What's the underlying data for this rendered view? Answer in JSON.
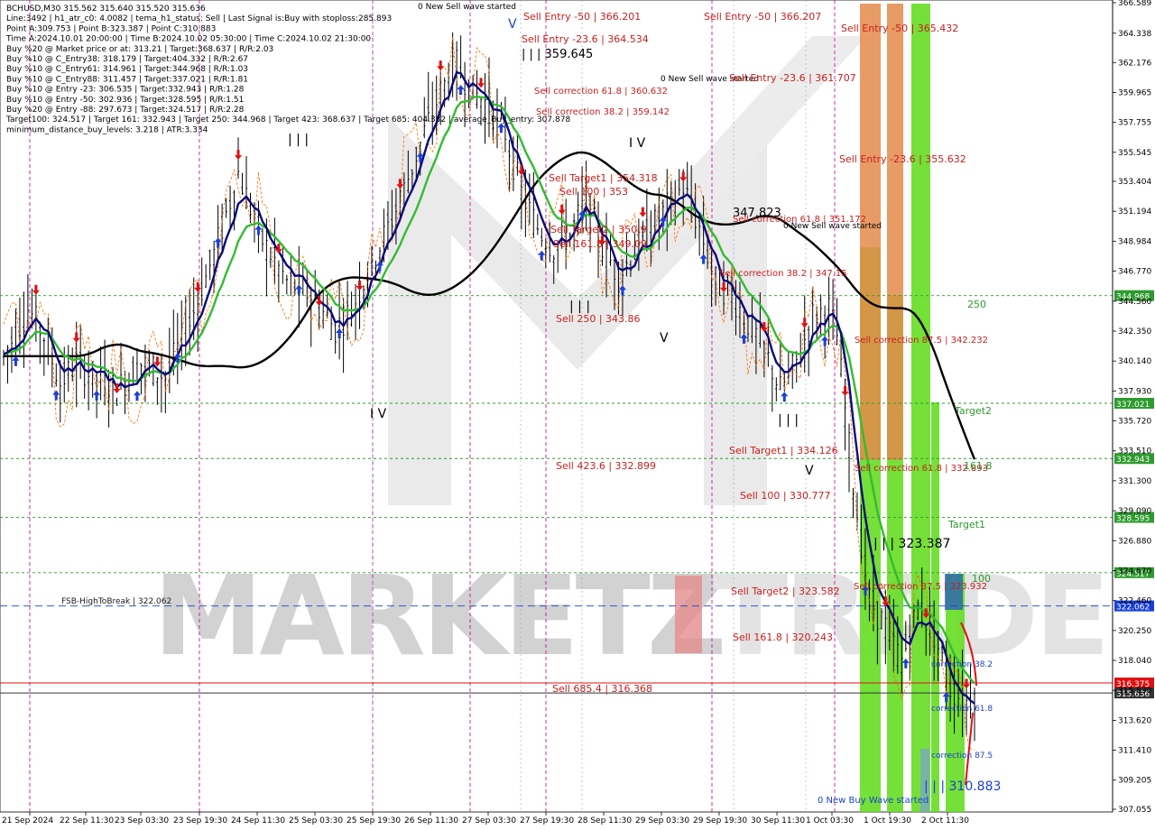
{
  "info_panel": {
    "lines": [
      "BCHUSD,M30  315.562 315.640 315.520 315.636",
      "Line:3492 | h1_atr_c0: 4.0082 | tema_h1_status: Sell | Last Signal is:Buy with stoploss:285.893",
      "Point A:309.753 | Point B:323.387 | Point C:310.883",
      "Time A:2024.10.01 20:00:00 | Time B:2024.10.02 05:30:00 | Time C:2024.10.02 21:30:00",
      "Buy %20 @ Market price or at: 313.21 | Target:368.637 | R/R:2.03",
      "Buy %10 @ C_Entry38: 318.179 | Target:404.332 | R/R:2.67",
      "Buy %10 @ C_Entry61: 314.961 | Target:344.968 | R/R:1.03",
      "Buy %10 @ C_Entry88: 311.457 | Target:337.021 | R/R:1.81",
      "Buy %10 @ Entry -23: 306.535 | Target:332.943 | R/R:1.28",
      "Buy %10 @ Entry -50: 302.936 | Target:328.595 | R/R:1.51",
      "Buy %20 @ Entry -88: 297.673 | Target:324.517 | R/R:2.28",
      "Target100: 324.517 | Target 161: 332.943 | Target 250: 344.968 | Target 423: 368.637 | Target 685: 404.332 | average_Buy_entry: 307.878",
      "minimum_distance_buy_levels: 3.218 | ATR:3.334"
    ]
  },
  "watermark": {
    "text_left": "MARKETZ",
    "text_right": "TRADE"
  },
  "chart_data": {
    "type": "candlestick",
    "symbol": "BCHUSD",
    "timeframe": "M30",
    "ylim": [
      307.055,
      366.589
    ],
    "y_ticks": [
      "366.589",
      "364.338",
      "362.176",
      "359.965",
      "357.755",
      "355.545",
      "353.404",
      "351.194",
      "348.984",
      "346.770",
      "344.560",
      "342.350",
      "340.140",
      "337.930",
      "335.720",
      "333.510",
      "331.300",
      "329.090",
      "326.880",
      "324.670",
      "322.460",
      "320.250",
      "318.040",
      "315.830",
      "313.620",
      "311.410",
      "309.205",
      "307.055"
    ],
    "x_tick_labels": [
      "21 Sep 2024",
      "22 Sep 11:30",
      "23 Sep 03:30",
      "23 Sep 19:30",
      "24 Sep 11:30",
      "25 Sep 03:30",
      "25 Sep 19:30",
      "26 Sep 11:30",
      "27 Sep 03:30",
      "27 Sep 19:30",
      "28 Sep 11:30",
      "29 Sep 03:30",
      "29 Sep 19:30",
      "30 Sep 11:30",
      "1 Oct 03:30",
      "1 Oct 19:30",
      "2 Oct 11:30"
    ],
    "horizontal_levels": [
      {
        "value": 344.968,
        "label": "344.968",
        "color": "#2e9b2e",
        "style": "dotted"
      },
      {
        "value": 337.021,
        "label": "337.021",
        "color": "#2e9b2e",
        "style": "dotted"
      },
      {
        "value": 332.943,
        "label": "332.943",
        "color": "#2e9b2e",
        "style": "dotted"
      },
      {
        "value": 328.595,
        "label": "328.595",
        "color": "#2e9b2e",
        "style": "dotted"
      },
      {
        "value": 324.517,
        "label": "324.517",
        "color": "#2e9b2e",
        "style": "dotted"
      },
      {
        "value": 322.062,
        "label": "322.062",
        "color": "#1a3fd6",
        "style": "dashed"
      },
      {
        "value": 316.375,
        "label": "316.375",
        "color": "#e01010",
        "style": "solid"
      },
      {
        "value": 315.636,
        "label": "315.636",
        "color": "#333333",
        "style": "solid"
      }
    ],
    "level_labels": [
      {
        "text": "250",
        "value": 344.968,
        "color": "#2e9b2e"
      },
      {
        "text": "Target2",
        "value": 337.021,
        "color": "#2e9b2e"
      },
      {
        "text": "161.8",
        "value": 332.943,
        "color": "#2e9b2e"
      },
      {
        "text": "Target1",
        "value": 328.595,
        "color": "#2e9b2e"
      },
      {
        "text": "100",
        "value": 324.517,
        "color": "#2e9b2e"
      },
      {
        "text": "FSB-HighToBreak | 322.062",
        "value": 322.062,
        "color": "#1a1a1a"
      },
      {
        "text": "Sell 685.4 | 316.368",
        "value": 316.375,
        "color": "#c81e1e"
      }
    ],
    "annotations": [
      {
        "text": "0 New Sell wave started",
        "color": "#000000"
      },
      {
        "text": "Sell Entry -50 | 366.201",
        "color": "#c81e1e"
      },
      {
        "text": "Sell Entry -23.6 | 364.534",
        "color": "#c81e1e"
      },
      {
        "text": "| | | 359.645",
        "color": "#000000"
      },
      {
        "text": "Sell correction 61.8 | 360.632",
        "color": "#c81e1e"
      },
      {
        "text": "Sell correction 38.2 | 359.142",
        "color": "#c81e1e"
      },
      {
        "text": "Sell Entry -50 | 366.207",
        "color": "#c81e1e"
      },
      {
        "text": "0 New Sell wave started",
        "color": "#000000"
      },
      {
        "text": "Sell Entry -23.6 | 361.707",
        "color": "#c81e1e"
      },
      {
        "text": "Sell Entry -50 | 365.432",
        "color": "#c81e1e"
      },
      {
        "text": "Sell Entry -23.6 | 355.632",
        "color": "#c81e1e"
      },
      {
        "text": "Sell Target1 | 354.318",
        "color": "#c81e1e"
      },
      {
        "text": "Sell 100 | 353",
        "color": "#c81e1e"
      },
      {
        "text": "Sell Target2 | 350.9",
        "color": "#c81e1e"
      },
      {
        "text": "Sell 161.8 | 349.09",
        "color": "#c81e1e"
      },
      {
        "text": "347.823",
        "color": "#000000"
      },
      {
        "text": "Sell correction 61.8 | 351.172",
        "color": "#c81e1e"
      },
      {
        "text": "0 New Sell wave started",
        "color": "#000000"
      },
      {
        "text": "Sell correction 38.2 | 347.15",
        "color": "#c81e1e"
      },
      {
        "text": "Sell 250 | 343.86",
        "color": "#c81e1e"
      },
      {
        "text": "Sell correction 87.5 | 342.232",
        "color": "#c81e1e"
      },
      {
        "text": "Sell Target1 | 334.126",
        "color": "#c81e1e"
      },
      {
        "text": "Sell 423.6 | 332.899",
        "color": "#c81e1e"
      },
      {
        "text": "Sell correction 61.8 | 332.893",
        "color": "#c81e1e"
      },
      {
        "text": "Sell 100 | 330.777",
        "color": "#c81e1e"
      },
      {
        "text": "| | | 323.387",
        "color": "#000000"
      },
      {
        "text": "Sell Target2 | 323.582",
        "color": "#c81e1e"
      },
      {
        "text": "Sell correction 87.5 | 323.932",
        "color": "#c81e1e"
      },
      {
        "text": "Sell 161.8 | 320.243",
        "color": "#c81e1e"
      },
      {
        "text": "correction 38.2",
        "color": "#1a3fd6"
      },
      {
        "text": "correction 61.8",
        "color": "#1a3fd6"
      },
      {
        "text": "correction 87.5",
        "color": "#1a3fd6"
      },
      {
        "text": "| | | 310.883",
        "color": "#1a3fd6"
      },
      {
        "text": "0 New Buy Wave started",
        "color": "#1a3fd6"
      }
    ],
    "wave_labels": [
      "V",
      "| | |",
      "I V",
      "| | |",
      "V",
      "I V",
      "| | |",
      "V"
    ],
    "colors": {
      "black_ma": "#000000",
      "green_ma": "#33bb33",
      "navy_ma": "#0a0a7a",
      "orange_trail": "#ff6a00",
      "buy_arrow": "#1a3fd6",
      "sell_arrow": "#e01010",
      "signal_dot": "#ffd700",
      "zone_green": "#66dd22",
      "zone_orange": "#e58a4a"
    }
  }
}
